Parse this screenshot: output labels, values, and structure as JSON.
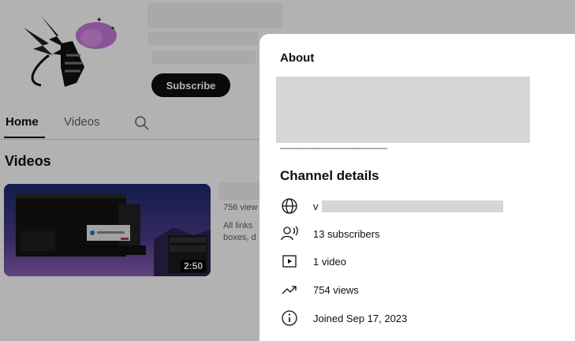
{
  "header": {
    "subscribe_label": "Subscribe"
  },
  "tabs": [
    {
      "label": "Home",
      "active": true
    },
    {
      "label": "Videos",
      "active": false
    }
  ],
  "videos_section": {
    "title": "Videos",
    "video": {
      "duration": "2:50",
      "views_partial": "756 view",
      "desc_line1": "All links",
      "desc_line2": "boxes, d"
    }
  },
  "about_panel": {
    "title": "About",
    "divider_text": "------------------------------------------------",
    "details_title": "Channel details",
    "details": [
      {
        "icon": "globe-icon",
        "text": "v"
      },
      {
        "icon": "subscribers-icon",
        "text": "13 subscribers"
      },
      {
        "icon": "video-play-icon",
        "text": "1 video"
      },
      {
        "icon": "trending-icon",
        "text": "754 views"
      },
      {
        "icon": "info-icon",
        "text": "Joined Sep 17, 2023"
      }
    ]
  },
  "colors": {
    "button_bg": "#0f0f0f",
    "redaction": "#d6d6d6",
    "overlay": "rgba(0,0,0,0.30)"
  }
}
